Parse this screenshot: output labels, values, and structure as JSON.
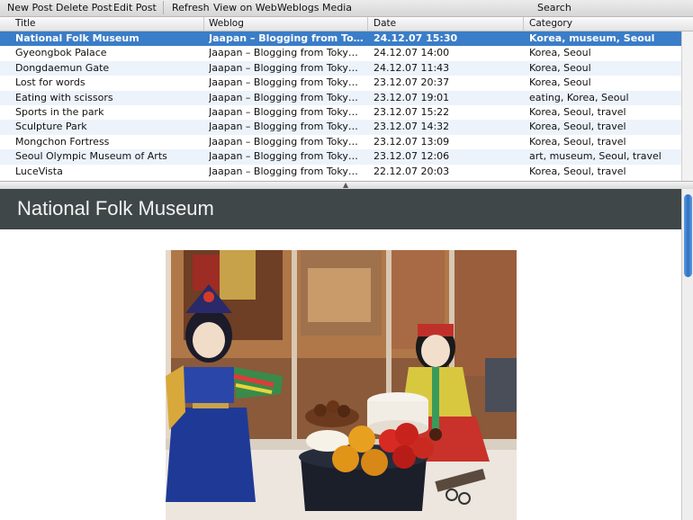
{
  "toolbar": {
    "new_post": "New Post",
    "delete_post": "Delete Post",
    "edit_post": "Edit Post",
    "refresh": "Refresh",
    "view_on_web": "View on Web",
    "weblogs": "Weblogs",
    "media": "Media",
    "search": "Search"
  },
  "columns": {
    "title": "Title",
    "weblog": "Weblog",
    "date": "Date",
    "category": "Category"
  },
  "posts": [
    {
      "title": "National Folk Museum",
      "weblog": "Jaapan – Blogging from Tokyo & …",
      "date": "24.12.07 15:30",
      "category": "Korea, museum, Seoul"
    },
    {
      "title": "Gyeongbok Palace",
      "weblog": "Jaapan – Blogging from Tokyo & …",
      "date": "24.12.07 14:00",
      "category": "Korea, Seoul"
    },
    {
      "title": "Dongdaemun Gate",
      "weblog": "Jaapan – Blogging from Tokyo & …",
      "date": "24.12.07 11:43",
      "category": "Korea, Seoul"
    },
    {
      "title": "Lost for words",
      "weblog": "Jaapan – Blogging from Tokyo & …",
      "date": "23.12.07 20:37",
      "category": "Korea, Seoul"
    },
    {
      "title": "Eating with scissors",
      "weblog": "Jaapan – Blogging from Tokyo & …",
      "date": "23.12.07 19:01",
      "category": "eating, Korea, Seoul"
    },
    {
      "title": "Sports in the park",
      "weblog": "Jaapan – Blogging from Tokyo & …",
      "date": "23.12.07 15:22",
      "category": "Korea, Seoul, travel"
    },
    {
      "title": "Sculpture Park",
      "weblog": "Jaapan – Blogging from Tokyo & …",
      "date": "23.12.07 14:32",
      "category": "Korea, Seoul, travel"
    },
    {
      "title": "Mongchon Fortress",
      "weblog": "Jaapan – Blogging from Tokyo & …",
      "date": "23.12.07 13:09",
      "category": "Korea, Seoul, travel"
    },
    {
      "title": "Seoul Olympic Museum of Arts",
      "weblog": "Jaapan – Blogging from Tokyo & …",
      "date": "23.12.07 12:06",
      "category": "art, museum, Seoul, travel"
    },
    {
      "title": "LuceVista",
      "weblog": "Jaapan – Blogging from Tokyo & …",
      "date": "22.12.07 20:03",
      "category": "Korea, Seoul, travel"
    }
  ],
  "selected_index": 0,
  "preview": {
    "post_title": "National Folk Museum"
  },
  "icons": {
    "splitter_grip": "caret-up-icon"
  },
  "colors": {
    "selection": "#3a7dc8",
    "title_bar": "#3f4748",
    "row_alt": "#edf3fb"
  }
}
